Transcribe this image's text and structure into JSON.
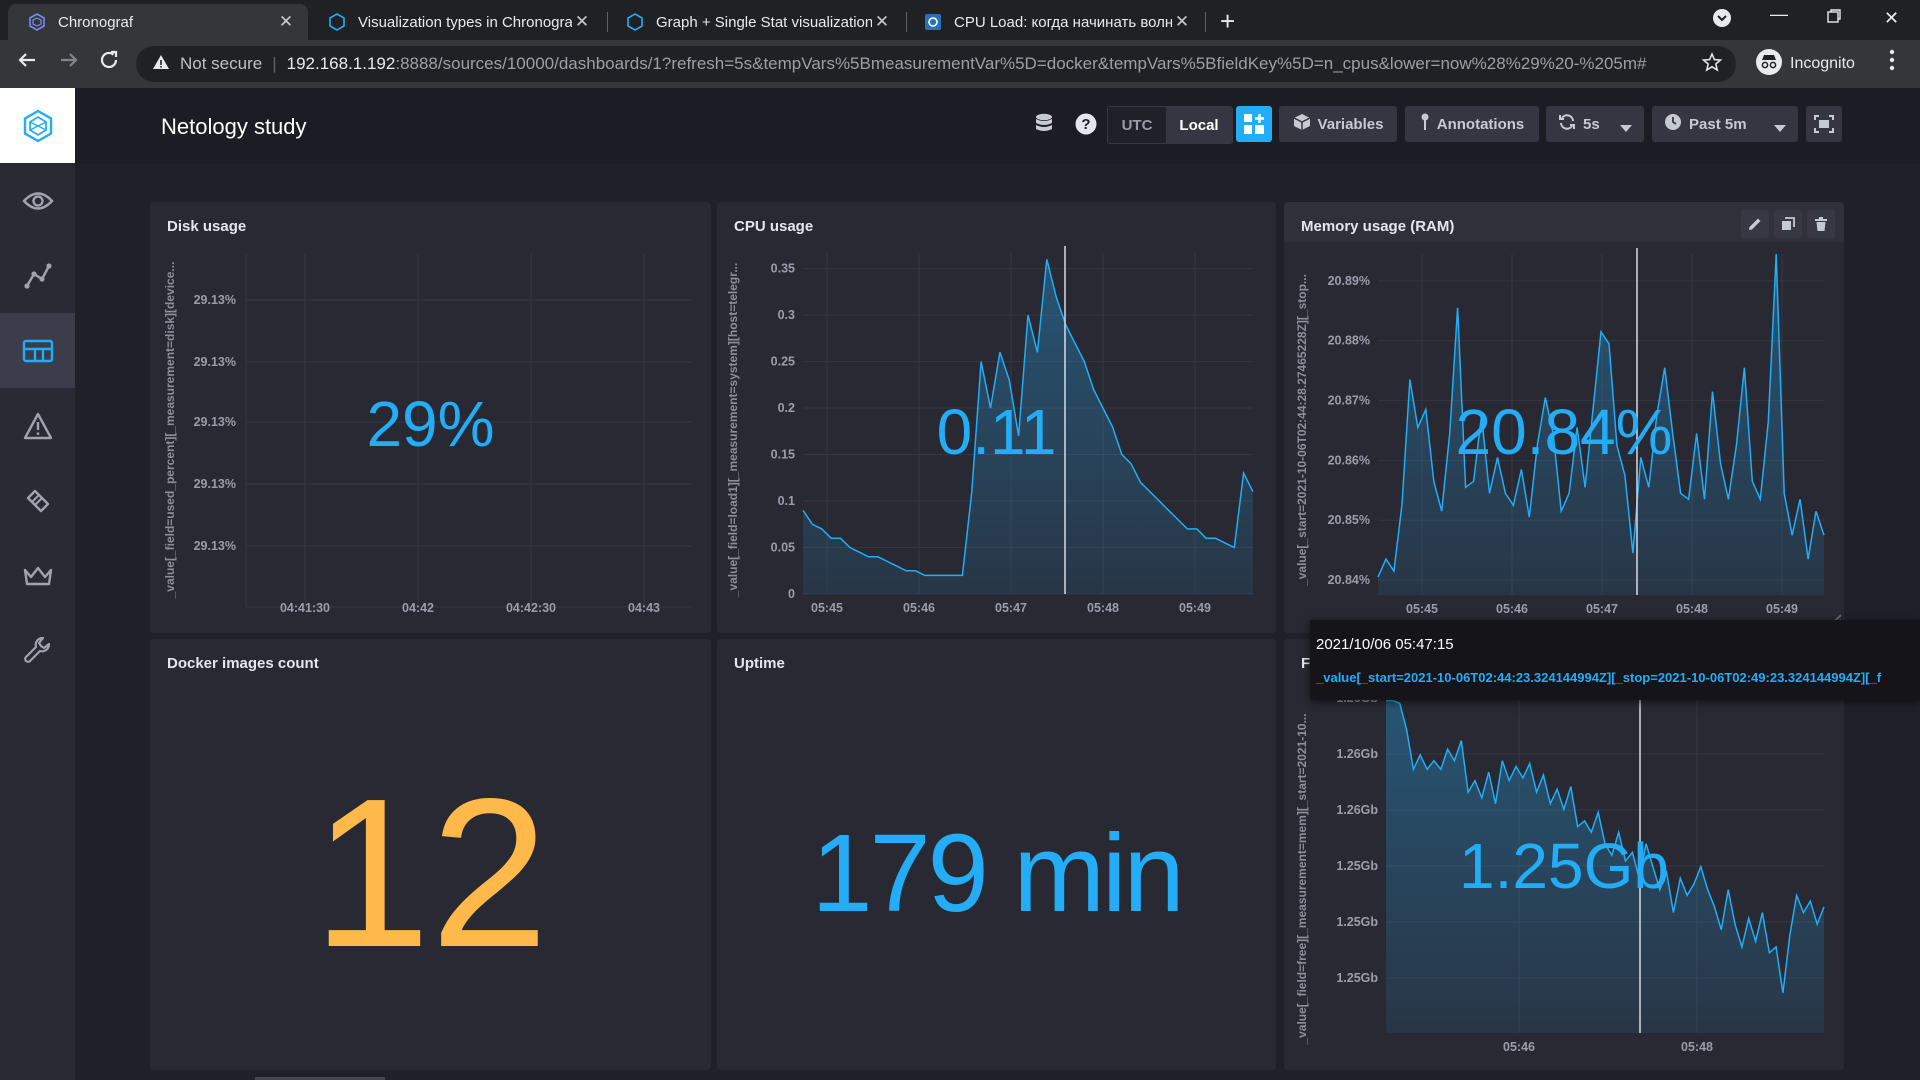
{
  "browser": {
    "tabs": [
      {
        "title": "Chronograf",
        "favicon": "chronograf-icon"
      },
      {
        "title": "Visualization types in Chronograf",
        "favicon": "chronograf-icon"
      },
      {
        "title": "Graph + Single Stat visualization",
        "favicon": "chronograf-icon"
      },
      {
        "title": "CPU Load: когда начинать волноваться",
        "favicon": "gear-icon"
      }
    ],
    "address": {
      "security_label": "Not secure",
      "host": "192.168.1.192",
      "path": ":8888/sources/10000/dashboards/1?refresh=5s&tempVars%5BmeasurementVar%5D=docker&tempVars%5BfieldKey%5D=n_cpus&lower=now%28%29%20-%205m#"
    },
    "profile_label": "Incognito"
  },
  "dashboard": {
    "title": "Netology study",
    "toolbar": {
      "utc_label": "UTC",
      "local_label": "Local",
      "variables_label": "Variables",
      "annotations_label": "Annotations",
      "refresh_label": "5s",
      "range_label": "Past 5m"
    }
  },
  "cells": {
    "disk": {
      "title": "Disk usage",
      "value": "29%",
      "ylabel": "_value[_field=used_percent][_measurement=disk][device..."
    },
    "cpu": {
      "title": "CPU usage",
      "value": "0.11",
      "ylabel": "_value[_field=load1][_measurement=system][host=telegr..."
    },
    "mem": {
      "title": "Memory usage (RAM)",
      "value": "20.84%",
      "ylabel": "_value[_start=2021-10-06T02:44:28.27465228Z][_stop..."
    },
    "docker": {
      "title": "Docker images count",
      "value": "12"
    },
    "uptime": {
      "title": "Uptime",
      "value": "179 min"
    },
    "free": {
      "title": "F",
      "value": "1.25Gb",
      "ylabel": "_value[_field=free][_measurement=mem][_start=2021-10..."
    }
  },
  "tooltip": {
    "time": "2021/10/06 05:47:15",
    "value": "_value[_start=2021-10-06T02:44:23.324144994Z][_stop=2021-10-06T02:49:23.324144994Z][_f"
  },
  "colors": {
    "accent_blue": "#22adf6",
    "accent_orange": "#ffb94a",
    "line_blue": "#22adf6",
    "panel_bg": "#292933",
    "app_bg": "#202028"
  },
  "chart_data": [
    {
      "type": "line",
      "title": "Disk usage",
      "x": [
        "04:41:30",
        "04:42",
        "04:42:30",
        "04:43"
      ],
      "yticks": [
        "29.13%",
        "29.13%",
        "29.13%",
        "29.13%",
        "29.13%"
      ],
      "grid": true
    },
    {
      "type": "area",
      "title": "CPU usage",
      "xticks": [
        "05:45",
        "05:46",
        "05:47",
        "05:48",
        "05:49"
      ],
      "yticks": [
        0,
        0.05,
        0.1,
        0.15,
        0.2,
        0.25,
        0.3,
        0.35
      ],
      "ylim": [
        0,
        0.37
      ],
      "series": [
        {
          "values": [
            0.09,
            0.075,
            0.07,
            0.06,
            0.06,
            0.05,
            0.045,
            0.04,
            0.04,
            0.035,
            0.03,
            0.025,
            0.025,
            0.02,
            0.02,
            0.02,
            0.02,
            0.02,
            0.11,
            0.25,
            0.2,
            0.26,
            0.23,
            0.17,
            0.3,
            0.26,
            0.36,
            0.32,
            0.29,
            0.27,
            0.25,
            0.22,
            0.2,
            0.18,
            0.15,
            0.14,
            0.12,
            0.11,
            0.1,
            0.09,
            0.08,
            0.07,
            0.07,
            0.06,
            0.06,
            0.055,
            0.05,
            0.13,
            0.11
          ]
        }
      ],
      "grid": true
    },
    {
      "type": "area",
      "title": "Memory usage (RAM)",
      "xticks": [
        "05:45",
        "05:46",
        "05:47",
        "05:48",
        "05:49"
      ],
      "yticks": [
        "20.84%",
        "20.85%",
        "20.86%",
        "20.87%",
        "20.88%",
        "20.89%"
      ],
      "ylim": [
        20.8375,
        20.8945
      ],
      "series": [
        {
          "values": [
            20.8405,
            20.8435,
            20.8415,
            20.8525,
            20.8735,
            20.8655,
            20.8685,
            20.8565,
            20.8515,
            20.8645,
            20.8855,
            20.8555,
            20.8565,
            20.8675,
            20.8545,
            20.8605,
            20.8545,
            20.8525,
            20.8585,
            20.8505,
            20.8625,
            20.8705,
            20.8645,
            20.8515,
            20.8545,
            20.8655,
            20.8555,
            20.8685,
            20.8815,
            20.8795,
            20.8625,
            20.8575,
            20.8445,
            20.8605,
            20.8555,
            20.8675,
            20.8755,
            20.8645,
            20.8545,
            20.8535,
            20.8645,
            20.8535,
            20.8715,
            20.8595,
            20.8535,
            20.8625,
            20.8755,
            20.8565,
            20.8535,
            20.8665,
            20.8945,
            20.8545,
            20.8475,
            20.8535,
            20.8435,
            20.8515,
            20.8475
          ]
        }
      ],
      "grid": true
    },
    {
      "type": "area",
      "title": "Free memory",
      "xticks": [
        "05:46",
        "05:48"
      ],
      "yticks": [
        "1.25Gb",
        "1.25Gb",
        "1.25Gb",
        "1.26Gb",
        "1.26Gb",
        "1.26Gb"
      ],
      "ylim": [
        0,
        6
      ],
      "series": [
        {
          "values": [
            5.8,
            5.8,
            5.75,
            5.3,
            4.6,
            4.85,
            4.6,
            4.75,
            4.6,
            4.95,
            4.75,
            5.1,
            4.2,
            4.4,
            4.1,
            4.55,
            4.0,
            4.75,
            4.4,
            4.65,
            4.45,
            4.7,
            4.2,
            4.5,
            4.0,
            4.25,
            3.9,
            4.3,
            3.6,
            3.7,
            3.5,
            3.85,
            3.3,
            3.1,
            3.5,
            3.0,
            3.15,
            2.7,
            3.3,
            2.9,
            2.5,
            2.8,
            2.1,
            2.7,
            2.4,
            2.6,
            2.9,
            2.5,
            2.2,
            1.8,
            2.5,
            1.9,
            1.5,
            2.0,
            1.6,
            2.1,
            1.4,
            1.5,
            0.7,
            1.7,
            2.4,
            2.1,
            2.3,
            1.9,
            2.2
          ]
        }
      ],
      "grid": true
    }
  ]
}
